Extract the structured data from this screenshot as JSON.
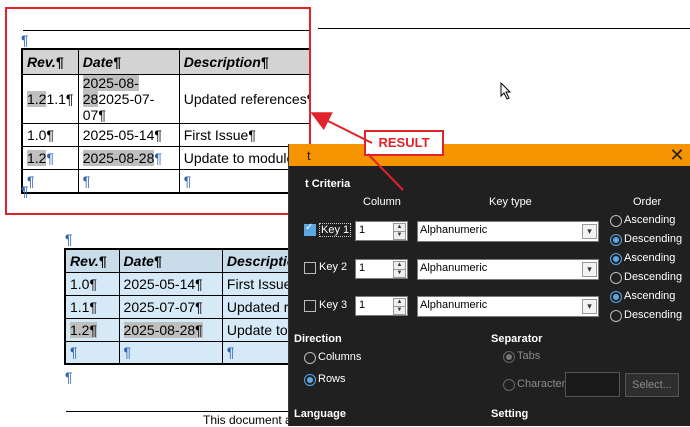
{
  "document": {
    "footer_text": "This document an",
    "pilcrow": "¶",
    "back_table": {
      "headers": [
        "Rev.¶",
        "Date¶",
        "Descriptio"
      ],
      "rows": [
        [
          "1.0¶",
          "2025-05-14¶",
          "First Issue¶"
        ],
        [
          "1.1¶",
          "2025-07-07¶",
          "Updated re"
        ],
        [
          "1.2¶",
          "2025-08-28¶",
          "Update to m"
        ],
        [
          "¶",
          "¶",
          "¶"
        ]
      ]
    }
  },
  "result_inset": {
    "table": {
      "headers": [
        "Rev.¶",
        "Date¶",
        "Description¶"
      ],
      "rows": [
        {
          "rev_hl": "1.2",
          "rev_rest": "1.1¶",
          "date_hl": "2025-08-28",
          "date_rest": "2025-07-07¶",
          "desc": "Updated references¶"
        },
        {
          "rev_hl": "",
          "rev_rest": "1.0¶",
          "date_hl": "",
          "date_rest": "2025-05-14¶",
          "desc": "First Issue¶"
        },
        {
          "rev_hl": "1.2",
          "rev_rest": "¶",
          "date_hl": "2025-08-28",
          "date_rest": "¶",
          "desc": "Update to modules¶"
        },
        {
          "rev_hl": "",
          "rev_rest": "¶",
          "date_hl": "",
          "date_rest": "¶",
          "desc": "¶"
        }
      ]
    }
  },
  "annotation": {
    "label": "RESULT",
    "color": "#e0232b"
  },
  "dialog": {
    "title": "t",
    "close_icon": "✕",
    "accent_color": "#f59300",
    "sort_criteria_label": "t Criteria",
    "column_header": "Column",
    "key_type_header": "Key type",
    "order_header": "Order",
    "keys": [
      {
        "label": "Key 1",
        "checked": true,
        "column": "1",
        "type": "Alphanumeric",
        "order": "Descending"
      },
      {
        "label": "Key 2",
        "checked": false,
        "column": "1",
        "type": "Alphanumeric",
        "order": "Ascending"
      },
      {
        "label": "Key 3",
        "checked": false,
        "column": "1",
        "type": "Alphanumeric",
        "order": "Ascending"
      }
    ],
    "order_options": [
      "Ascending",
      "Descending"
    ],
    "direction": {
      "title": "Direction",
      "options": [
        "Columns",
        "Rows"
      ],
      "selected": "Rows"
    },
    "separator": {
      "title": "Separator",
      "tabs": "Tabs",
      "character": "Character",
      "select_button": "Select..."
    },
    "language_title": "Language",
    "setting_title": "Setting"
  }
}
